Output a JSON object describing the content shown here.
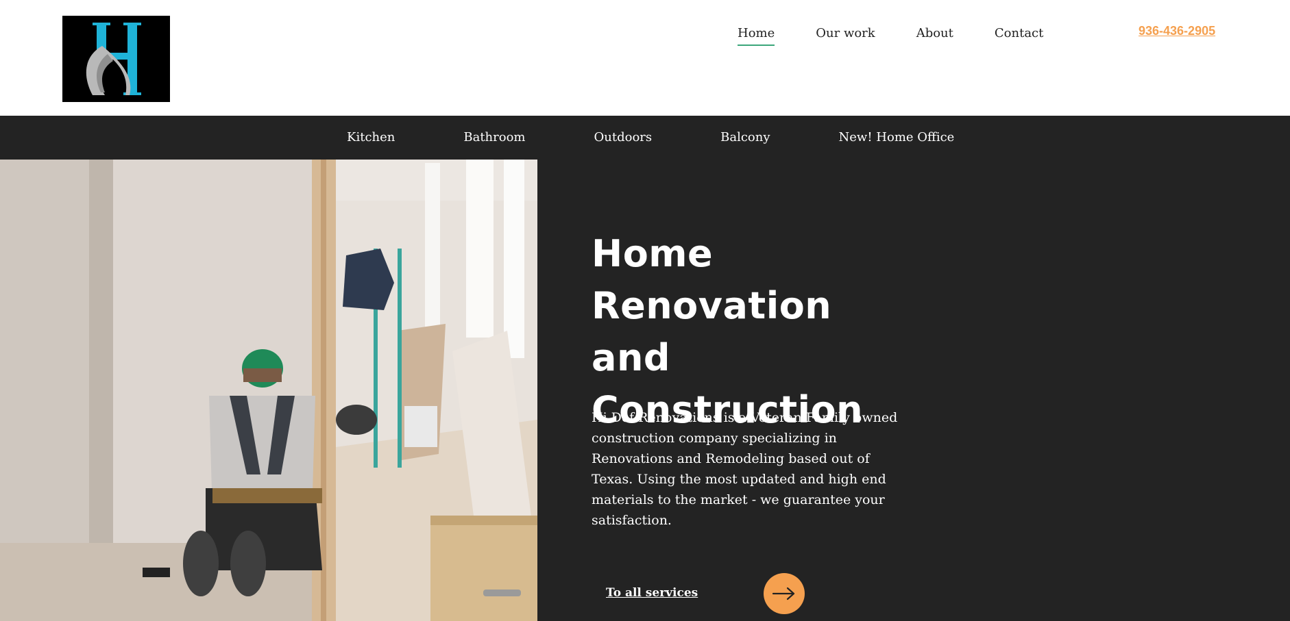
{
  "header": {
    "logo_alt": "H",
    "nav": [
      {
        "label": "Home",
        "active": true
      },
      {
        "label": "Our work",
        "active": false
      },
      {
        "label": "About",
        "active": false
      },
      {
        "label": "Contact",
        "active": false
      }
    ],
    "phone": "936-436-2905"
  },
  "subnav": {
    "items": [
      "Kitchen",
      "Bathroom",
      "Outdoors",
      "Balcony",
      "New! Home Office"
    ]
  },
  "hero": {
    "title_lines": [
      "Home",
      "Renovation and",
      "Construction"
    ],
    "description": "Hi Def Renovations is a Veteran Family owned construction company specializing in Renovations and Remodeling based out of Texas. Using the most updated and high end materials to the market - we guarantee your satisfaction.",
    "cta_label": "To all services",
    "cta_icon": "arrow-right-icon"
  },
  "colors": {
    "accent": "#f5a04f",
    "dark_bg": "#232323",
    "nav_underline": "#3aa57a",
    "logo_cyan": "#1fb3d8"
  }
}
